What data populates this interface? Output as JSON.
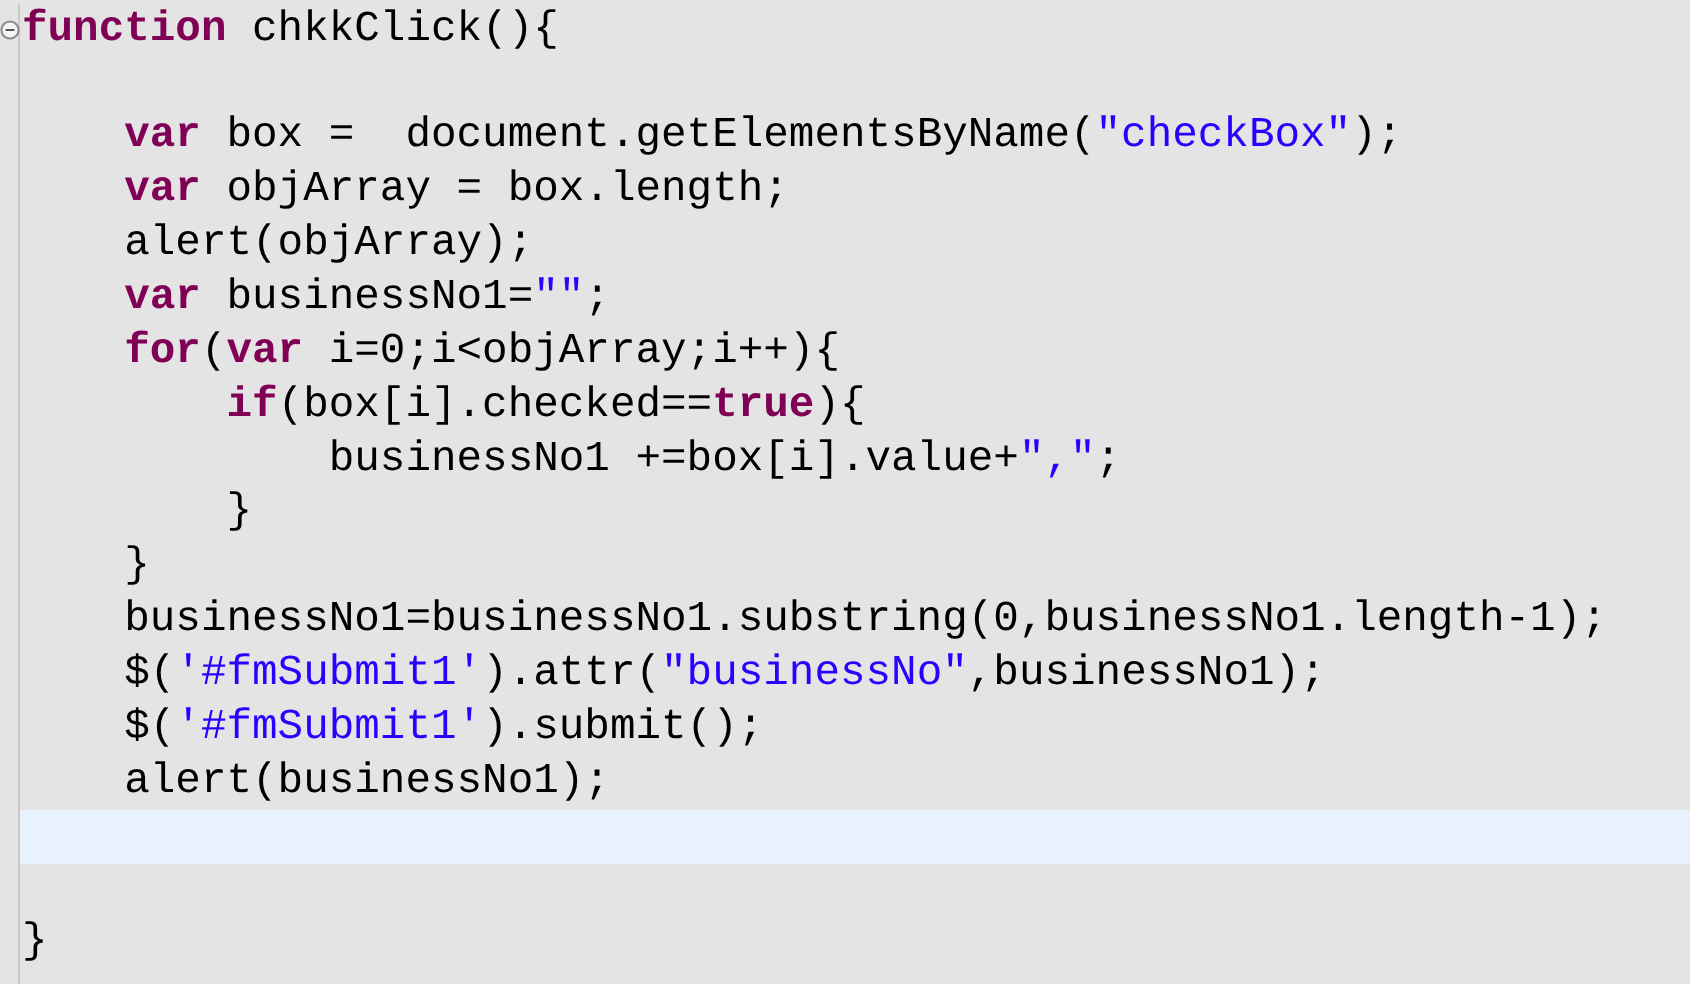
{
  "editor": {
    "lines": [
      {
        "fold_marker": true,
        "current": false,
        "tokens": [
          {
            "kind": "keyword",
            "text": "function"
          },
          {
            "kind": "plain",
            "text": " chkkClick(){"
          }
        ]
      },
      {
        "fold_marker": false,
        "current": false
      },
      {
        "fold_marker": false,
        "current": false,
        "tokens": [
          {
            "kind": "keyword",
            "text": "    var"
          },
          {
            "kind": "plain",
            "text": " box =  document.getElementsByName("
          },
          {
            "kind": "string",
            "text": "\"checkBox\""
          },
          {
            "kind": "plain",
            "text": ");"
          }
        ]
      },
      {
        "fold_marker": false,
        "current": false,
        "tokens": [
          {
            "kind": "keyword",
            "text": "    var"
          },
          {
            "kind": "plain",
            "text": " objArray = box.length;"
          }
        ]
      },
      {
        "fold_marker": false,
        "current": false,
        "tokens": [
          {
            "kind": "plain",
            "text": "    alert(objArray);"
          }
        ]
      },
      {
        "fold_marker": false,
        "current": false,
        "tokens": [
          {
            "kind": "keyword",
            "text": "    var"
          },
          {
            "kind": "plain",
            "text": " businessNo1="
          },
          {
            "kind": "string",
            "text": "\"\""
          },
          {
            "kind": "plain",
            "text": ";"
          }
        ]
      },
      {
        "fold_marker": false,
        "current": false,
        "tokens": [
          {
            "kind": "keyword",
            "text": "    for"
          },
          {
            "kind": "plain",
            "text": "("
          },
          {
            "kind": "keyword",
            "text": "var"
          },
          {
            "kind": "plain",
            "text": " i=0;i<objArray;i++){"
          }
        ]
      },
      {
        "fold_marker": false,
        "current": false,
        "tokens": [
          {
            "kind": "keyword",
            "text": "        if"
          },
          {
            "kind": "plain",
            "text": "(box[i].checked=="
          },
          {
            "kind": "keyword",
            "text": "true"
          },
          {
            "kind": "plain",
            "text": "){"
          }
        ]
      },
      {
        "fold_marker": false,
        "current": false,
        "tokens": [
          {
            "kind": "plain",
            "text": "            businessNo1 +=box[i].value+"
          },
          {
            "kind": "string",
            "text": "\",\""
          },
          {
            "kind": "plain",
            "text": ";"
          }
        ]
      },
      {
        "fold_marker": false,
        "current": false,
        "tokens": [
          {
            "kind": "plain",
            "text": "        }"
          }
        ]
      },
      {
        "fold_marker": false,
        "current": false,
        "tokens": [
          {
            "kind": "plain",
            "text": "    }"
          }
        ]
      },
      {
        "fold_marker": false,
        "current": false,
        "tokens": [
          {
            "kind": "plain",
            "text": "    businessNo1=businessNo1.substring(0,businessNo1.length-1);"
          }
        ]
      },
      {
        "fold_marker": false,
        "current": false,
        "tokens": [
          {
            "kind": "plain",
            "text": "    $("
          },
          {
            "kind": "string",
            "text": "'#fmSubmit1'"
          },
          {
            "kind": "plain",
            "text": ").attr("
          },
          {
            "kind": "string",
            "text": "\"businessNo\""
          },
          {
            "kind": "plain",
            "text": ",businessNo1);"
          }
        ]
      },
      {
        "fold_marker": false,
        "current": false,
        "tokens": [
          {
            "kind": "plain",
            "text": "    $("
          },
          {
            "kind": "string",
            "text": "'#fmSubmit1'"
          },
          {
            "kind": "plain",
            "text": ").submit();"
          }
        ]
      },
      {
        "fold_marker": false,
        "current": false,
        "tokens": [
          {
            "kind": "plain",
            "text": "    alert(businessNo1);"
          }
        ]
      },
      {
        "fold_marker": false,
        "current": true
      },
      {
        "fold_marker": false,
        "current": false
      },
      {
        "fold_marker": false,
        "current": false,
        "tokens": [
          {
            "kind": "plain",
            "text": "}"
          }
        ]
      }
    ]
  }
}
